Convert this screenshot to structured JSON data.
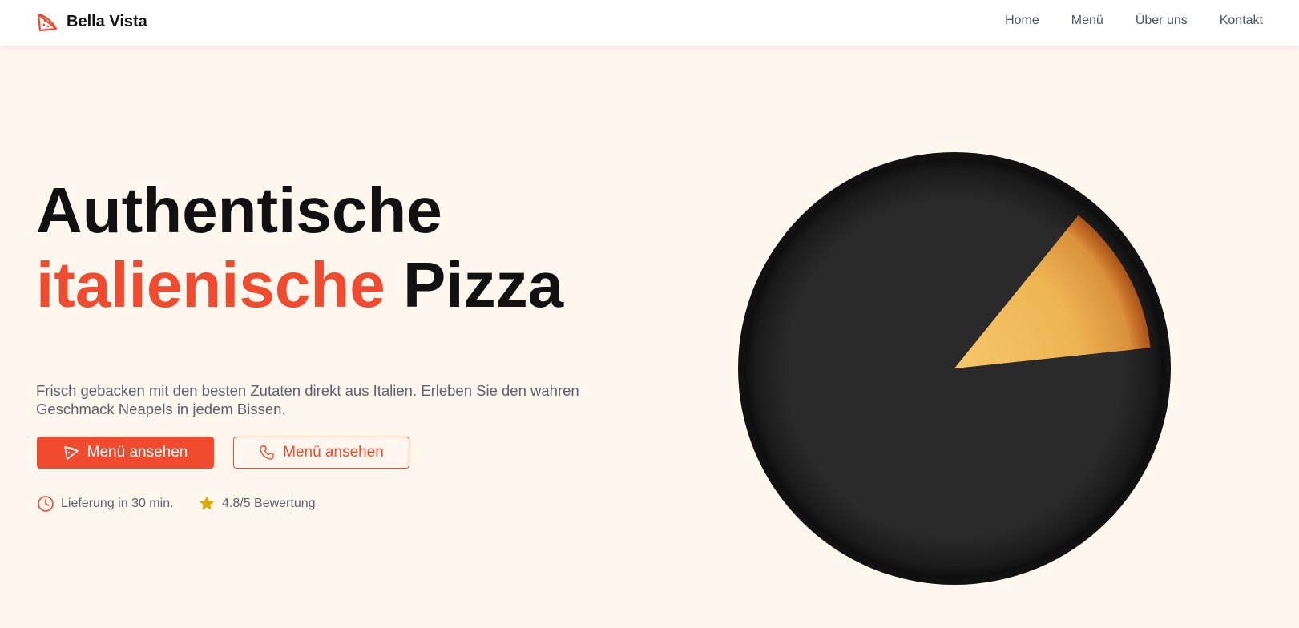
{
  "nav": {
    "brand": "Bella Vista",
    "brand_icon": "pizza-slice-icon",
    "links": [
      "Home",
      "Menü",
      "Über uns",
      "Kontakt"
    ]
  },
  "hero": {
    "headline_line1": "Authentische",
    "headline_accent": "italienische",
    "headline_rest": "Pizza",
    "subtitle": "Frisch gebacken mit den besten Zutaten direkt aus Italien. Erleben Sie den wahren Geschmack Neapels in jedem Bissen.",
    "primary_button": {
      "label": "Menü ansehen",
      "icon": "pizza-slice-icon"
    },
    "secondary_button": {
      "label": "Menü ansehen",
      "icon": "phone-icon"
    },
    "delivery": {
      "icon": "clock-icon",
      "text": "Lieferung in 30 min."
    },
    "rating": {
      "icon": "star-icon",
      "text": "4.8/5 Bewertung"
    },
    "image": "pizza-image"
  },
  "colors": {
    "accent": "#f04a2f",
    "background": "#fff6ee",
    "star": "#e0a800",
    "text_muted": "#5b6270"
  }
}
